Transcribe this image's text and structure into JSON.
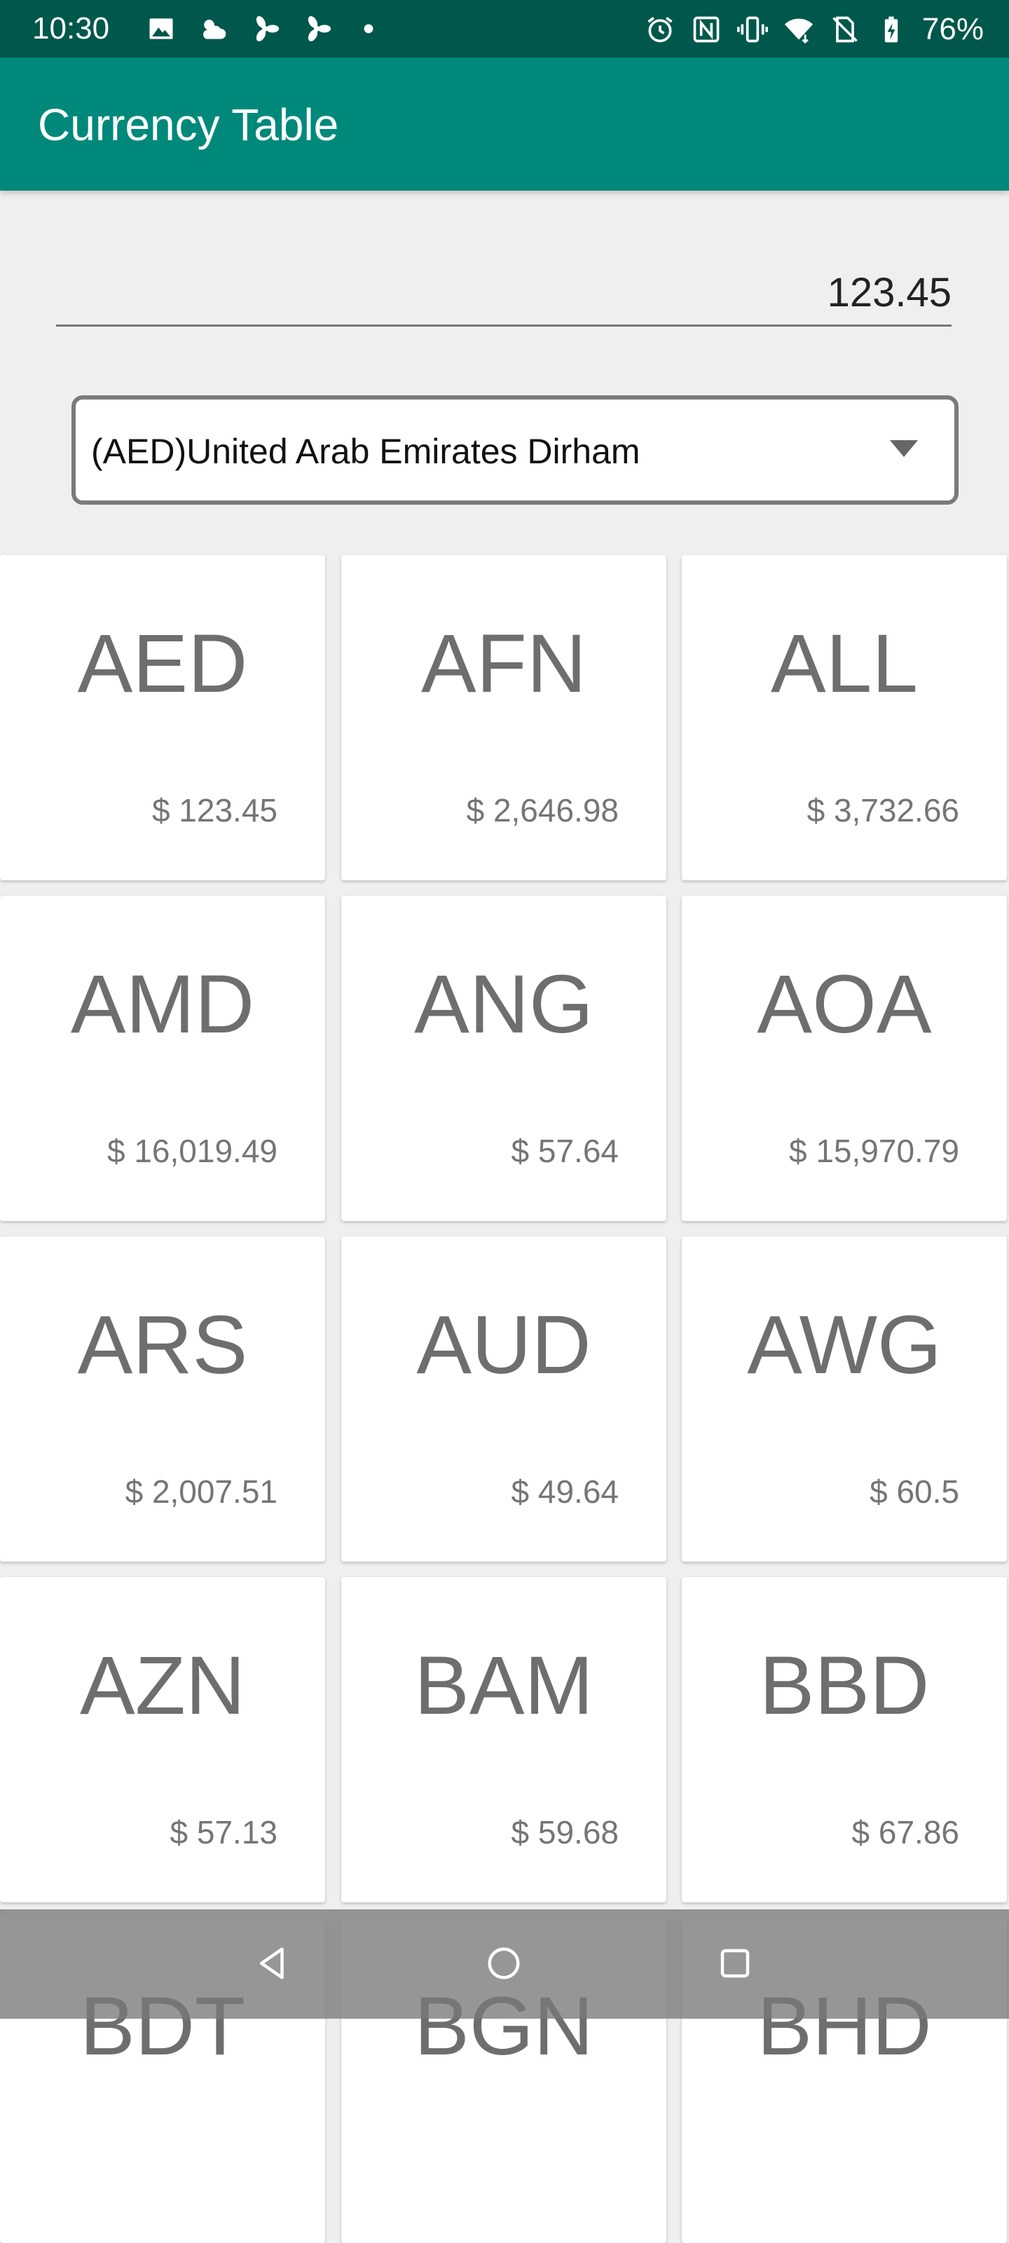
{
  "status_bar": {
    "time": "10:30",
    "battery_percent": "76%",
    "left_icons": [
      "image-icon",
      "weather-icon",
      "fan-icon",
      "fan-icon",
      "dot-icon"
    ],
    "right_icons": [
      "alarm-icon",
      "nfc-icon",
      "vibrate-icon",
      "wifi-icon",
      "no-sim-icon",
      "battery-charging-icon"
    ]
  },
  "app_bar": {
    "title": "Currency Table"
  },
  "amount_input": {
    "value": "123.45"
  },
  "currency_select": {
    "selected": "(AED)United Arab Emirates Dirham"
  },
  "currencies": [
    {
      "code": "AED",
      "amount": "$ 123.45"
    },
    {
      "code": "AFN",
      "amount": "$ 2,646.98"
    },
    {
      "code": "ALL",
      "amount": "$ 3,732.66"
    },
    {
      "code": "AMD",
      "amount": "$ 16,019.49"
    },
    {
      "code": "ANG",
      "amount": "$ 57.64"
    },
    {
      "code": "AOA",
      "amount": "$ 15,970.79"
    },
    {
      "code": "ARS",
      "amount": "$ 2,007.51"
    },
    {
      "code": "AUD",
      "amount": "$ 49.64"
    },
    {
      "code": "AWG",
      "amount": "$ 60.5"
    },
    {
      "code": "AZN",
      "amount": "$ 57.13"
    },
    {
      "code": "BAM",
      "amount": "$ 59.68"
    },
    {
      "code": "BBD",
      "amount": "$ 67.86"
    },
    {
      "code": "BDT",
      "amount": ""
    },
    {
      "code": "BGN",
      "amount": ""
    },
    {
      "code": "BHD",
      "amount": ""
    }
  ],
  "nav_bar": {
    "buttons": [
      "back-icon",
      "home-icon",
      "recents-icon"
    ]
  },
  "colors": {
    "primary": "#00897b",
    "primary_dark": "#00574b",
    "background": "#efefef"
  }
}
